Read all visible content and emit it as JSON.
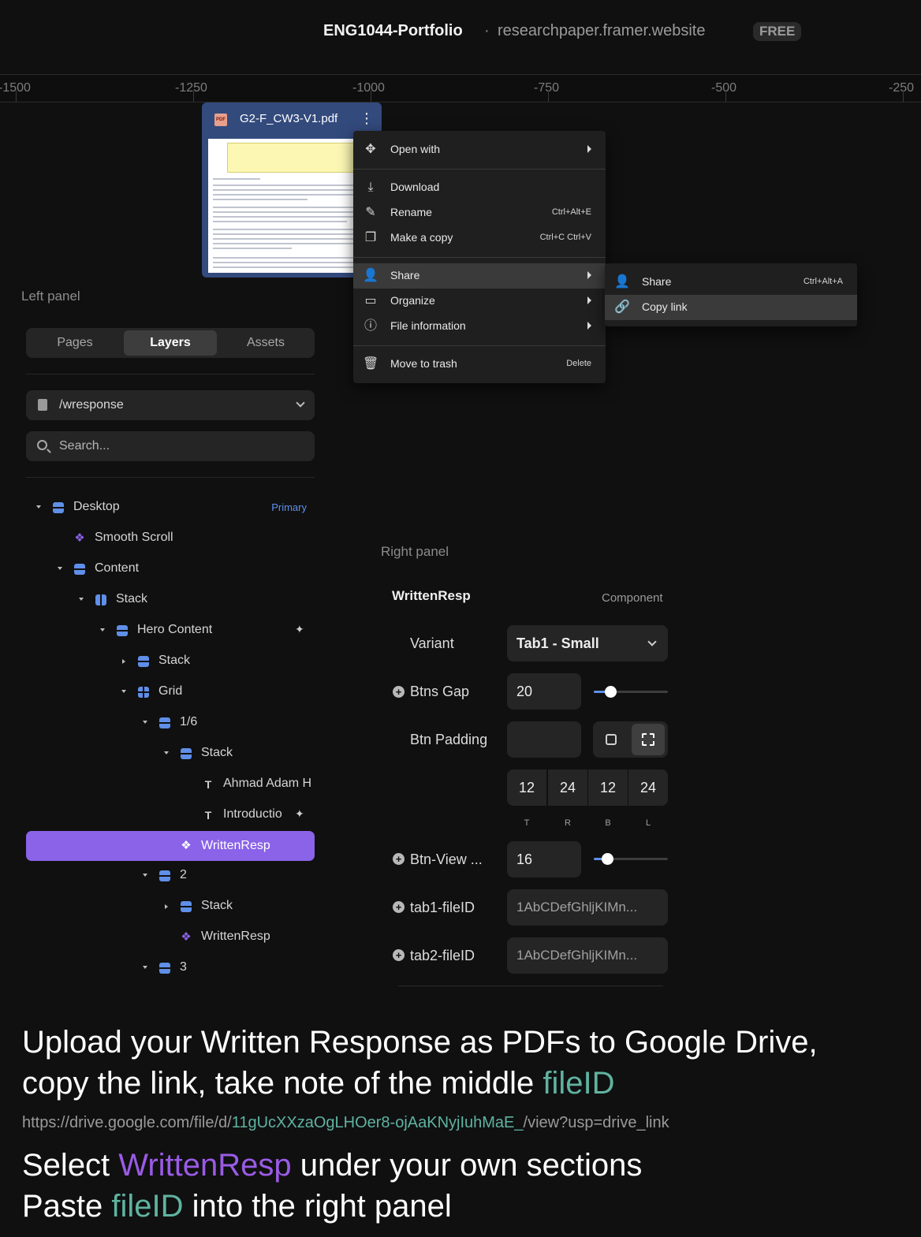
{
  "header": {
    "project_name": "ENG1044-Portfolio",
    "separator": "·",
    "site_url": "researchpaper.framer.website",
    "plan_badge": "FREE"
  },
  "ruler": {
    "labels": [
      "-1500",
      "-1250",
      "-1000",
      "-750",
      "-500",
      "-250"
    ]
  },
  "pdf_card": {
    "file_icon": "PDF",
    "filename": "G2-F_CW3-V1.pdf",
    "menu_icon": "⋮"
  },
  "context_menu": {
    "items": [
      {
        "icon": "move-icon",
        "label": "Open with",
        "submenu": true
      },
      {
        "icon": "download-icon",
        "label": "Download"
      },
      {
        "icon": "rename-icon",
        "label": "Rename",
        "shortcut": "Ctrl+Alt+E"
      },
      {
        "icon": "copy-icon",
        "label": "Make a copy",
        "shortcut": "Ctrl+C Ctrl+V"
      },
      {
        "icon": "person-add-icon",
        "label": "Share",
        "submenu": true
      },
      {
        "icon": "folder-icon",
        "label": "Organize",
        "submenu": true
      },
      {
        "icon": "info-icon",
        "label": "File information",
        "submenu": true
      },
      {
        "icon": "trash-icon",
        "label": "Move to trash",
        "shortcut": "Delete"
      }
    ],
    "submenu": [
      {
        "icon": "person-add-icon",
        "label": "Share",
        "shortcut": "Ctrl+Alt+A"
      },
      {
        "icon": "link-icon",
        "label": "Copy link"
      }
    ]
  },
  "left_panel": {
    "section_label": "Left panel",
    "tabs": [
      "Pages",
      "Layers",
      "Assets"
    ],
    "active_tab": "Layers",
    "page_select": "/wresponse",
    "search_placeholder": "Search...",
    "layers": [
      {
        "label": "Desktop",
        "badge": "Primary",
        "icon": "stack-icon"
      },
      {
        "label": "Smooth Scroll",
        "icon": "component-icon"
      },
      {
        "label": "Content",
        "icon": "stack-icon"
      },
      {
        "label": "Stack",
        "icon": "horizontal-stack-icon"
      },
      {
        "label": "Hero Content",
        "icon": "stack-icon"
      },
      {
        "label": "Stack",
        "icon": "stack-icon"
      },
      {
        "label": "Grid",
        "icon": "grid-icon"
      },
      {
        "label": "1/6",
        "icon": "stack-icon"
      },
      {
        "label": "Stack",
        "icon": "stack-icon"
      },
      {
        "label": "Ahmad Adam H",
        "icon": "text-icon"
      },
      {
        "label": "Introductio",
        "icon": "text-icon"
      },
      {
        "label": "WrittenResp",
        "icon": "component-icon",
        "selected": true
      },
      {
        "label": "2",
        "icon": "stack-icon"
      },
      {
        "label": "Stack",
        "icon": "stack-icon"
      },
      {
        "label": "WrittenResp",
        "icon": "component-icon"
      },
      {
        "label": "3",
        "icon": "stack-icon"
      }
    ]
  },
  "right_panel": {
    "section_label": "Right panel",
    "component_name": "WrittenResp",
    "component_type": "Component",
    "variant_label": "Variant",
    "variant_value": "Tab1 - Small",
    "btns_gap_label": "Btns Gap",
    "btns_gap_value": "20",
    "btns_gap_level": 0.22,
    "btn_padding_label": "Btn Padding",
    "padding_values": [
      "12",
      "24",
      "12",
      "24"
    ],
    "padding_sides": [
      "T",
      "R",
      "B",
      "L"
    ],
    "btn_view_label": "Btn-View ...",
    "btn_view_value": "16",
    "btn_view_level": 0.18,
    "tab1_label": "tab1-fileID",
    "tab1_value": "1AbCDefGhljKIMn...",
    "tab2_label": "tab2-fileID",
    "tab2_value": "1AbCDefGhljKIMn..."
  },
  "instructions": {
    "line1": "Upload your Written Response as PDFs to Google Drive,",
    "line2_pre": "copy the link, take note of the middle ",
    "line2_hl": "fileID",
    "url_pre": "https://drive.google.com/file/d/",
    "url_id": "11gUcXXzaOgLHOer8-ojAaKNyjIuhMaE_",
    "url_post": "/view?usp=drive_link",
    "line3_pre": "Select ",
    "line3_hl": "WrittenResp",
    "line3_post": " under your own sections",
    "line4_pre": "Paste ",
    "line4_hl": "fileID",
    "line4_post": " into the right panel"
  },
  "colors": {
    "accent_violet": "#8a63e8",
    "accent_teal": "#5fb3a1",
    "layer_icon_blue": "#5f8fe8",
    "pdf_card_blue": "#334a7d"
  }
}
